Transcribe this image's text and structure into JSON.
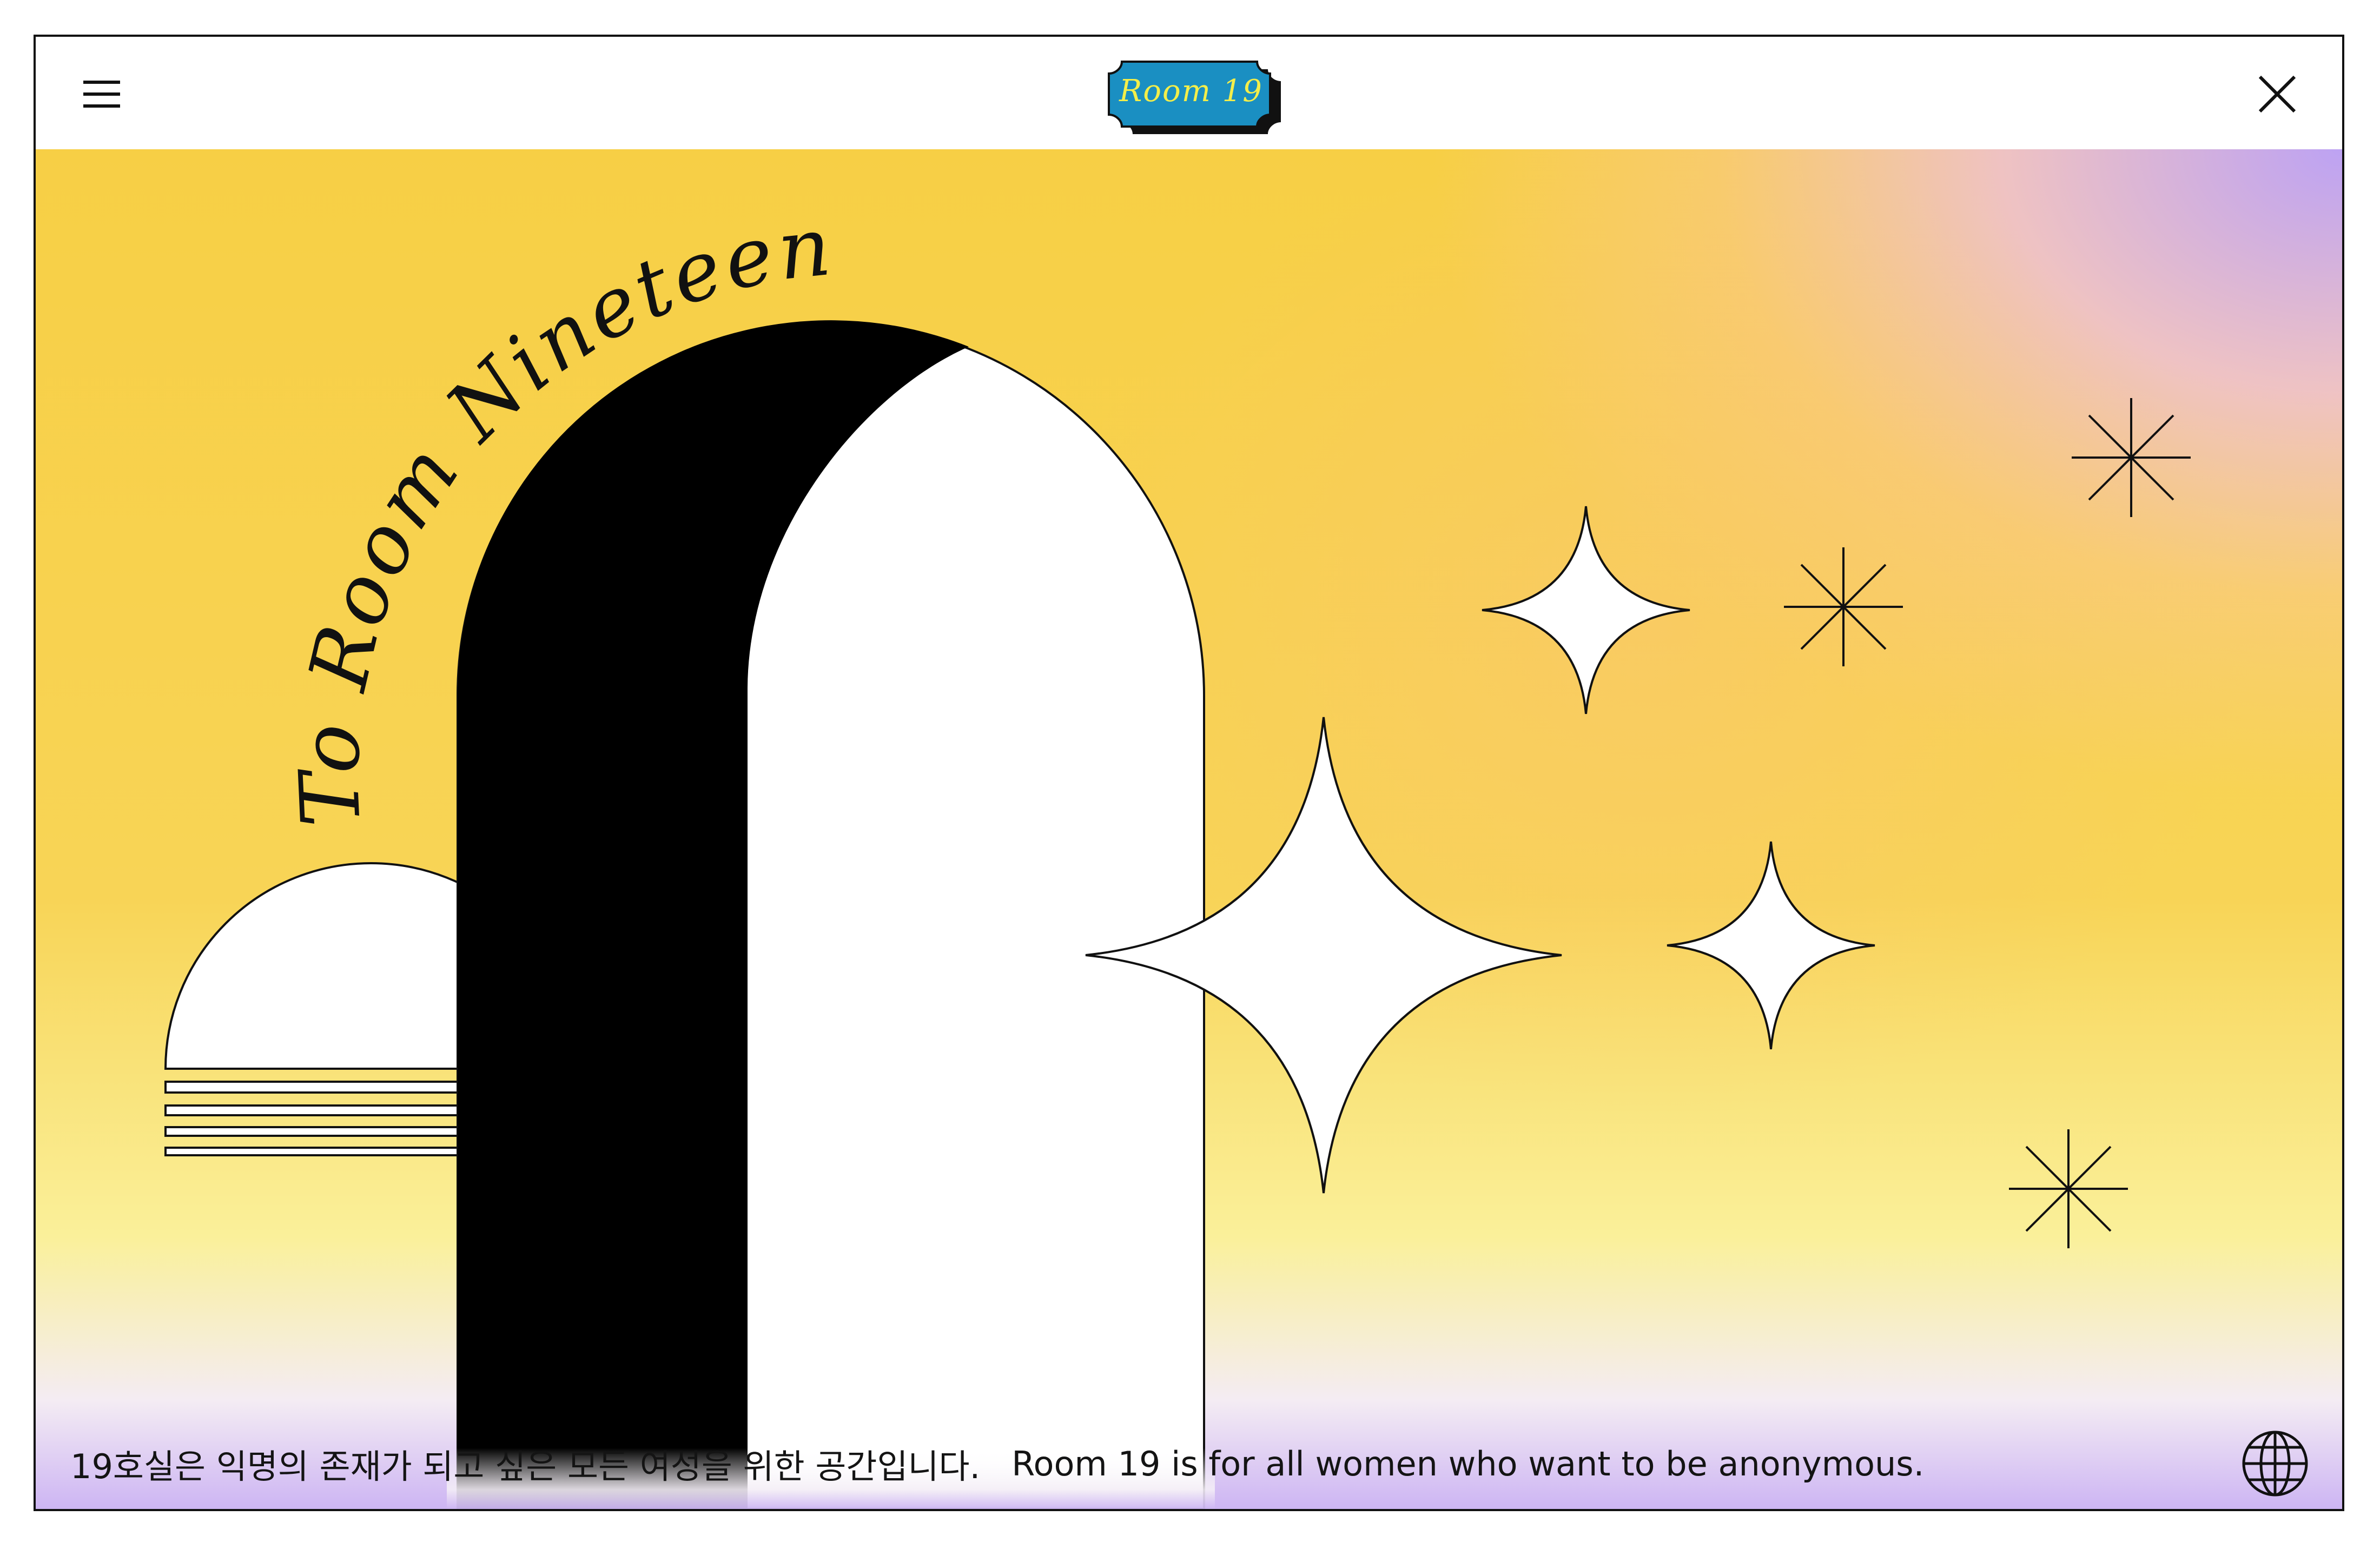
{
  "header": {
    "logo_text": "Room 19",
    "menu_icon": "hamburger-menu-icon",
    "close_icon": "close-icon"
  },
  "hero": {
    "arched_title": "To Room Nineteen",
    "caption_ko": "19호실은 익명의 존재가 되고 싶은 모든 여성을 위한 공간입니다.",
    "caption_en": "Room 19 is for all women who want to be anonymous.",
    "language_icon": "globe-icon"
  },
  "colors": {
    "logo_background": "#1a8fc2",
    "logo_text": "#f3ee4a",
    "gradient_yellow": "#f7cf45",
    "gradient_pink": "#ecbeec",
    "gradient_violet": "#baa0fc",
    "ink": "#111111"
  }
}
